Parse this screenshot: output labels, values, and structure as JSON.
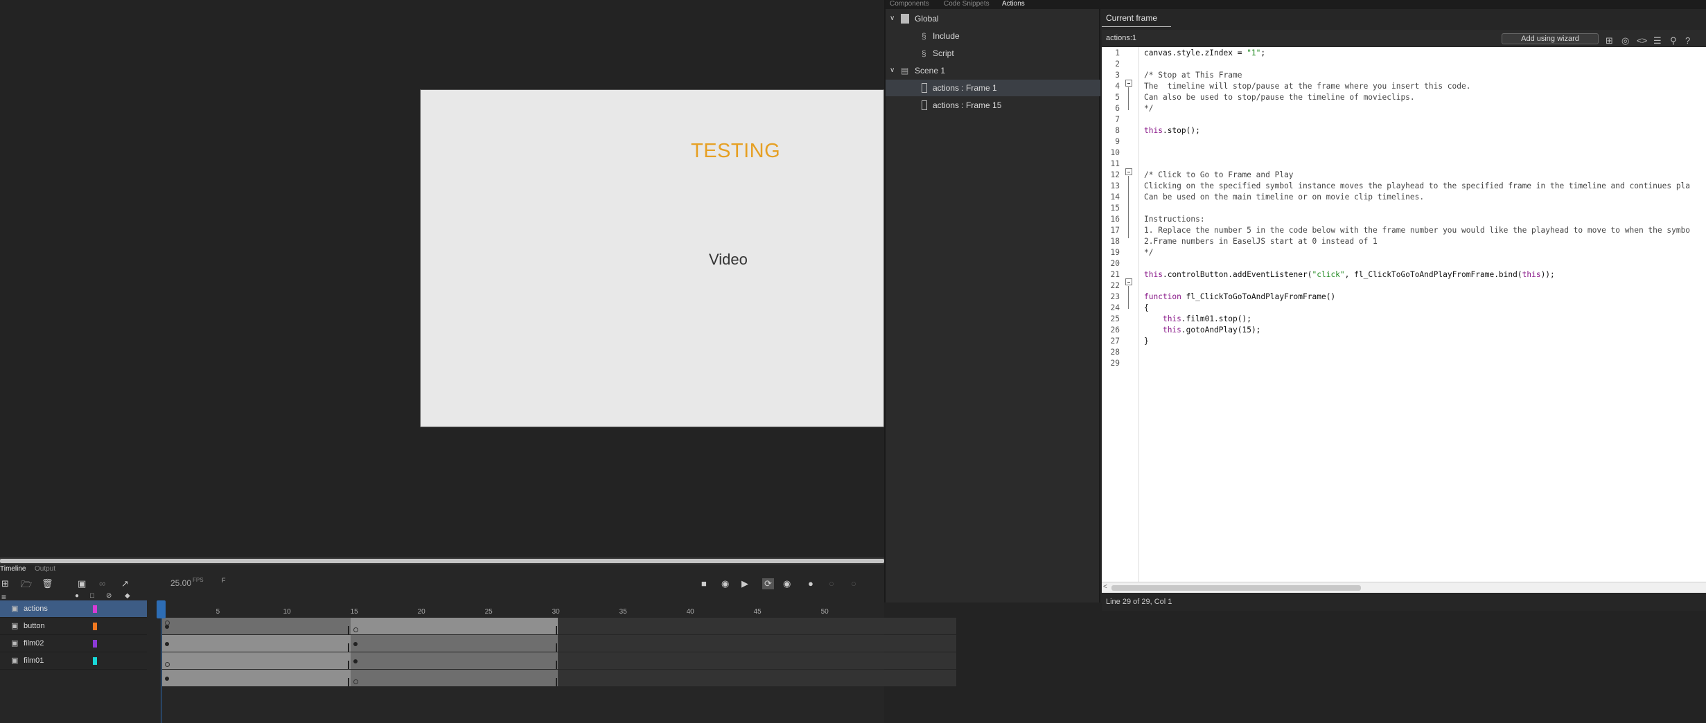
{
  "stage": {
    "title": "TESTING",
    "subtitle": "Video"
  },
  "panel_tabs": [
    "Components",
    "Code Snippets",
    "Actions"
  ],
  "tree": [
    {
      "label": "Global",
      "icon": "document-icon"
    },
    {
      "label": "Include",
      "icon": "script-icon"
    },
    {
      "label": "Script",
      "icon": "script-icon"
    },
    {
      "label": "Scene 1",
      "icon": "scene-icon"
    },
    {
      "label": "actions : Frame 1",
      "icon": "frame-icon"
    },
    {
      "label": "actions : Frame 15",
      "icon": "frame-icon"
    }
  ],
  "editor": {
    "tab": "Current frame",
    "location": "actions:1",
    "wizard": "Add using wizard",
    "status": "Line 29 of 29, Col 1"
  },
  "code_lines": [
    "canvas.style.zIndex = \"1\";",
    "",
    "/* Stop at This Frame",
    "The  timeline will stop/pause at the frame where you insert this code.",
    "Can also be used to stop/pause the timeline of movieclips.",
    "*/",
    "",
    "this.stop();",
    "",
    "",
    "",
    "/* Click to Go to Frame and Play",
    "Clicking on the specified symbol instance moves the playhead to the specified frame in the timeline and continues pla",
    "Can be used on the main timeline or on movie clip timelines.",
    "",
    "Instructions:",
    "1. Replace the number 5 in the code below with the frame number you would like the playhead to move to when the symbo",
    "2.Frame numbers in EaselJS start at 0 instead of 1",
    "*/",
    "",
    "this.controlButton.addEventListener(\"click\", fl_ClickToGoToAndPlayFromFrame.bind(this));",
    "",
    "function fl_ClickToGoToAndPlayFromFrame()",
    "{",
    "    this.film01.stop();",
    "    this.gotoAndPlay(15);",
    "}",
    "",
    ""
  ],
  "bottom_tabs": [
    "Timeline",
    "Output"
  ],
  "timeline": {
    "fps_value": "25.00",
    "fps_unit": "FPS",
    "frame_label": "F",
    "ruler_ticks": [
      "5",
      "10",
      "15",
      "20",
      "25",
      "30",
      "35",
      "40",
      "45",
      "50"
    ],
    "layers": [
      {
        "name": "actions",
        "color": "#d63bd6"
      },
      {
        "name": "button",
        "color": "#f07820"
      },
      {
        "name": "film02",
        "color": "#8c3ad6"
      },
      {
        "name": "film01",
        "color": "#18d8d8"
      }
    ]
  }
}
